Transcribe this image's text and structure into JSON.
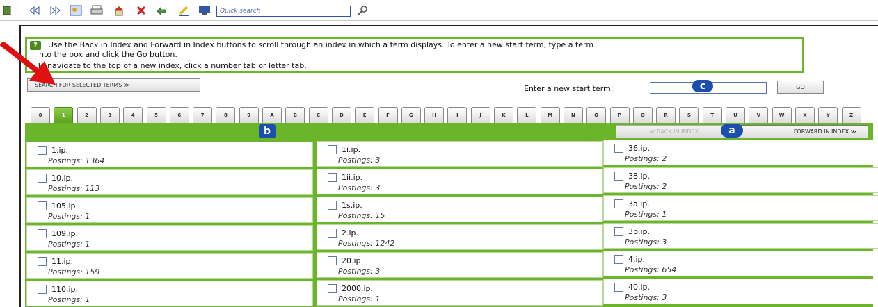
{
  "toolbar": {
    "icons": [
      "first-icon",
      "back-icon",
      "forward-icon",
      "view-icon",
      "print-icon",
      "home-icon",
      "close-icon",
      "refresh-icon",
      "highlight-icon",
      "monitor-icon",
      "search-go-icon"
    ],
    "search_placeholder": "Quick search"
  },
  "help": {
    "line1": "Use the Back in Index and Forward in Index buttons to scroll through an index in which a term displays. To enter a new start term, type a term",
    "line2": "into the box and click  the Go button.",
    "line3": "To navigate to the top of a new index, click a number tab or letter tab."
  },
  "buttons": {
    "search_selected": "SEARCH FOR SELECTED TERMS ≫",
    "go": "GO",
    "back_in_index": "≪ BACK IN INDEX",
    "forward_in_index": "FORWARD IN INDEX ≫"
  },
  "start_term": {
    "label": "Enter a new start term:",
    "value": ""
  },
  "tabs": [
    "0",
    "1",
    "2",
    "3",
    "4",
    "5",
    "6",
    "7",
    "8",
    "9",
    "A",
    "B",
    "C",
    "D",
    "E",
    "F",
    "G",
    "H",
    "I",
    "J",
    "K",
    "L",
    "M",
    "N",
    "O",
    "P",
    "Q",
    "R",
    "S",
    "T",
    "U",
    "V",
    "W",
    "X",
    "Y",
    "Z"
  ],
  "active_tab": "1",
  "markers": {
    "a": "a",
    "b": "b",
    "c": "c"
  },
  "columns": [
    [
      {
        "term": "1.ip.",
        "postings": "Postings: 1364"
      },
      {
        "term": "10.ip.",
        "postings": "Postings: 113"
      },
      {
        "term": "105.ip.",
        "postings": "Postings: 1"
      },
      {
        "term": "109.ip.",
        "postings": "Postings: 1"
      },
      {
        "term": "11.ip.",
        "postings": "Postings: 159"
      },
      {
        "term": "110.ip.",
        "postings": "Postings: 1"
      }
    ],
    [
      {
        "term": "1i.ip.",
        "postings": "Postings: 3"
      },
      {
        "term": "1ii.ip.",
        "postings": "Postings: 3"
      },
      {
        "term": "1s.ip.",
        "postings": "Postings: 15"
      },
      {
        "term": "2.ip.",
        "postings": "Postings: 1242"
      },
      {
        "term": "20.ip.",
        "postings": "Postings: 3"
      },
      {
        "term": "2000.ip.",
        "postings": "Postings: 1"
      }
    ],
    [
      {
        "term": "36.ip.",
        "postings": "Postings: 2"
      },
      {
        "term": "38.ip.",
        "postings": "Postings: 2"
      },
      {
        "term": "3a.ip.",
        "postings": "Postings: 1"
      },
      {
        "term": "3b.ip.",
        "postings": "Postings: 3"
      },
      {
        "term": "4.ip.",
        "postings": "Postings: 654"
      },
      {
        "term": "40.ip.",
        "postings": "Postings: 3"
      }
    ]
  ],
  "colors": {
    "accent_green": "#6bb52a",
    "marker_blue": "#1b4fae",
    "arrow_red": "#e01010"
  }
}
